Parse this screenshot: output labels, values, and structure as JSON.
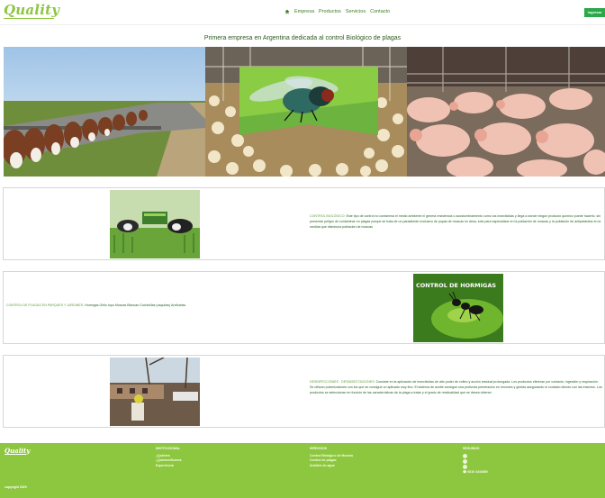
{
  "header": {
    "logo_text": "Quality",
    "nav": [
      {
        "label": "Empresa"
      },
      {
        "label": "Productos"
      },
      {
        "label": "Servicios"
      },
      {
        "label": "Contacto"
      }
    ],
    "login_label": "Ingresar"
  },
  "headline": "Primera empresa en Argentina dedicada al control Biológico de plagas",
  "cards": [
    {
      "caption": "CONTROL BIOLÓGICO:",
      "text": "Este tipo de control no contamina el medio ambiente ni genera resistencia o acostumbramiento como los insecticidas y llega a donde ningún producto químico puede hacerlo, sin presentar peligro de contaminar en plagas porque se trata de un parasitoide exclusivo de pupas de moscas en desa, sólo para especializar en la población de moscas y la población de antiparásitos en la medida que disminuía población de moscas"
    },
    {
      "caption": "CONTROL DE PLAGAS EN PARQUES Y JARDINES:",
      "text": "Hormigas Grillo topo Moscas Blancas Cochinillas (vaquitas) Arañuelas",
      "image_title": "CONTROL DE HORMIGAS"
    },
    {
      "caption": "DESINFECCIONES · DESINSECTACIONES:",
      "text": "Consiste en la aplicación de insecticidas de alto poder de volteo y acción residual prolongada. Los productos eliminan por contacto, ingestión y respiración. Se utilizan pulverizadores con los que se consigue un aplicado muy fino. El sistema de aceite consigue una profunda penetración en rincones y grietas asegurando el contacto directo con las insectos. Los productos se seleccionan en función de las características de la plaga a tratar y el grado de residualidad que se desea obtener."
    }
  ],
  "footer": {
    "logo_text": "Quality",
    "col1": {
      "heading": "INSTITUCIONAL",
      "items": [
        "¿Quiénes",
        "¿Quiénes/Somos",
        "Experiencia"
      ]
    },
    "col2": {
      "heading": "SERVICIOS",
      "items": [
        "Control Biológico de Moscas",
        "Control de plagas",
        "Análisis de agua"
      ]
    },
    "col3": {
      "heading": "SEGUINOS",
      "phone": "0810 4444880"
    },
    "copyright": "copyright 2020"
  },
  "colors": {
    "brand_green": "#8dc63f",
    "dark_green": "#2e5c1f",
    "button_green": "#2aa84a"
  }
}
